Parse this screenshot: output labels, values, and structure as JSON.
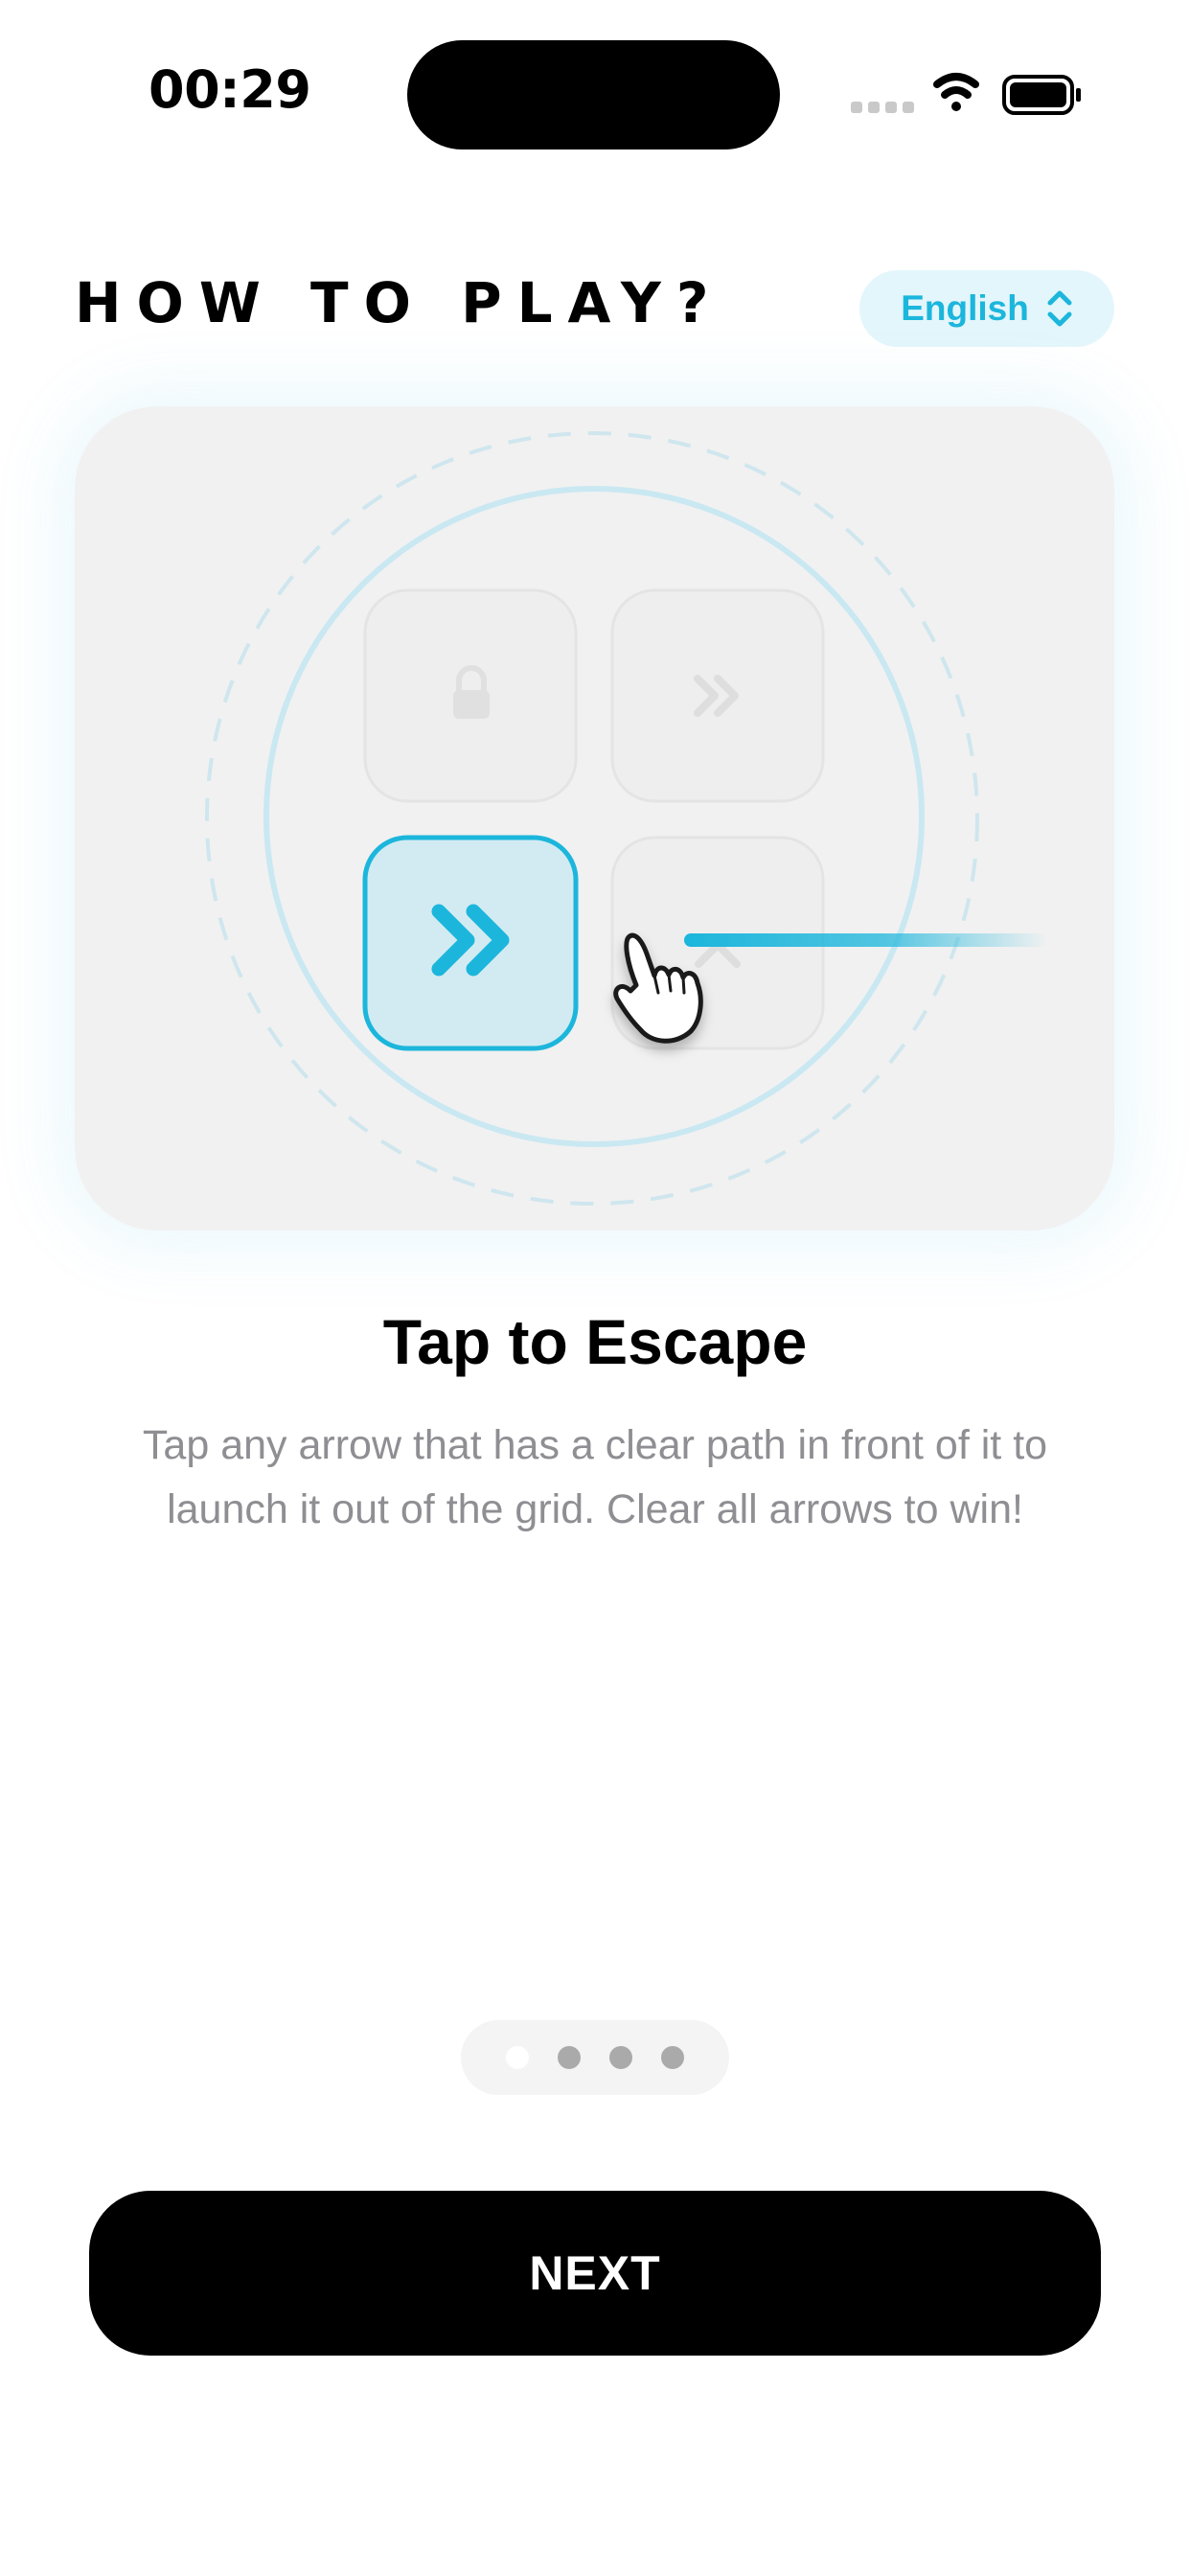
{
  "status_bar": {
    "time": "00:29",
    "icons": [
      "cellular-signal-icon",
      "wifi-icon",
      "battery-icon"
    ]
  },
  "header": {
    "title": "HOW TO PLAY?",
    "language": "English"
  },
  "illustration": {
    "tiles": [
      "lock-icon",
      "double-chevron-right-icon",
      "double-chevron-right-icon",
      "chevron-up-icon"
    ],
    "pointer": "hand-pointer-icon",
    "accent_color": "#1cb6dc"
  },
  "step": {
    "title": "Tap to Escape",
    "description": "Tap any arrow that has a clear path in front of it to launch it out of the grid. Clear all arrows to win!"
  },
  "pagination": {
    "total": 4,
    "current": 1
  },
  "actions": {
    "next_label": "NEXT"
  },
  "colors": {
    "accent": "#1cb6dc",
    "button": "#000000",
    "card_bg": "#f1f1f1",
    "lang_bg": "#e3f6fb"
  }
}
